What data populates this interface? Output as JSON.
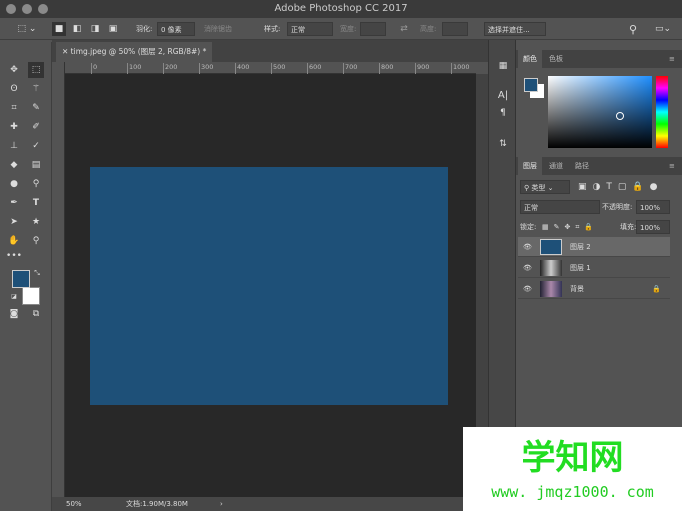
{
  "window": {
    "title": "Adobe Photoshop CC 2017"
  },
  "options": {
    "feather_label": "羽化:",
    "feather_value": "0 像素",
    "antialias": "消除锯齿",
    "style_label": "样式:",
    "style_value": "正常",
    "width_label": "宽度:",
    "height_label": "高度:",
    "select_mask": "选择并遮住..."
  },
  "document": {
    "tab": "timg.jpeg @ 50% (图层 2, RGB/8#) *",
    "fill_color": "#1e5078",
    "zoom": "50%",
    "doc_size": "文档:1.90M/3.80M"
  },
  "ruler": {
    "h": [
      "0",
      "100",
      "200",
      "300",
      "400",
      "500",
      "600",
      "700",
      "800",
      "900",
      "1000"
    ]
  },
  "color_panel": {
    "tabs": [
      "颜色",
      "色板"
    ]
  },
  "layers_panel": {
    "tabs": [
      "图层",
      "通道",
      "路径"
    ],
    "filter": "类型",
    "blend_mode": "正常",
    "opacity_label": "不透明度:",
    "opacity": "100%",
    "lock_label": "锁定:",
    "fill_label": "填充:",
    "fill": "100%",
    "layers": [
      {
        "name": "图层 2",
        "selected": true
      },
      {
        "name": "图层 1",
        "selected": false
      },
      {
        "name": "背景",
        "selected": false
      }
    ]
  },
  "watermark": {
    "title": "学知网",
    "url": "www. jmqz1000. com"
  },
  "colors": {
    "foreground": "#1e5078",
    "background": "#ffffff"
  }
}
